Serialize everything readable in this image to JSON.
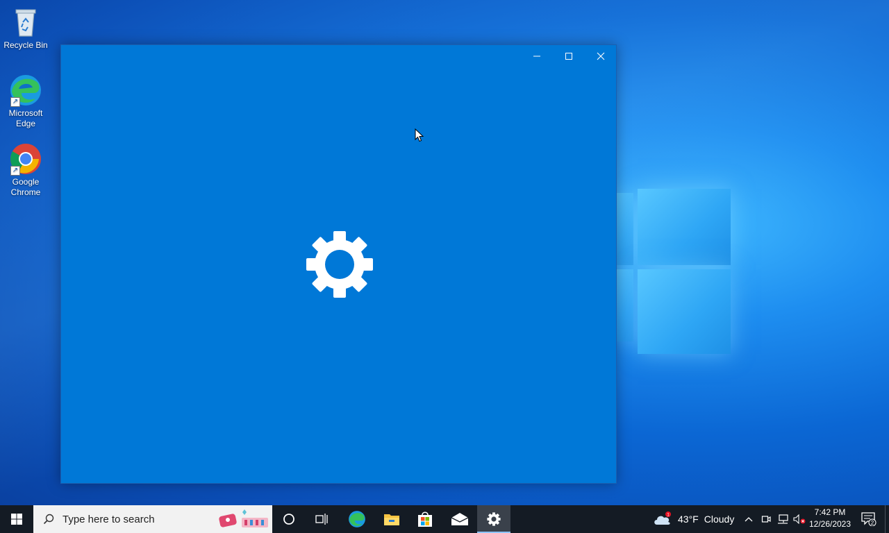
{
  "desktop": {
    "icons": [
      {
        "label": "Recycle Bin"
      },
      {
        "label": "Microsoft Edge"
      },
      {
        "label": "Google Chrome"
      }
    ]
  },
  "window": {
    "app": "Settings",
    "splash_icon": "gear-icon",
    "background_color": "#0078d7",
    "controls": [
      "minimize-icon",
      "maximize-icon",
      "close-icon"
    ]
  },
  "taskbar": {
    "search_placeholder": "Type here to search",
    "pinned": [
      "cortana-icon",
      "task-view-icon",
      "edge-icon",
      "file-explorer-icon",
      "store-icon",
      "mail-icon",
      "settings-icon"
    ],
    "active_app": "Settings",
    "weather": {
      "temp": "43°F",
      "condition": "Cloudy",
      "badge": "1"
    },
    "time": "7:42 PM",
    "date": "12/26/2023",
    "notification_count": "2"
  }
}
